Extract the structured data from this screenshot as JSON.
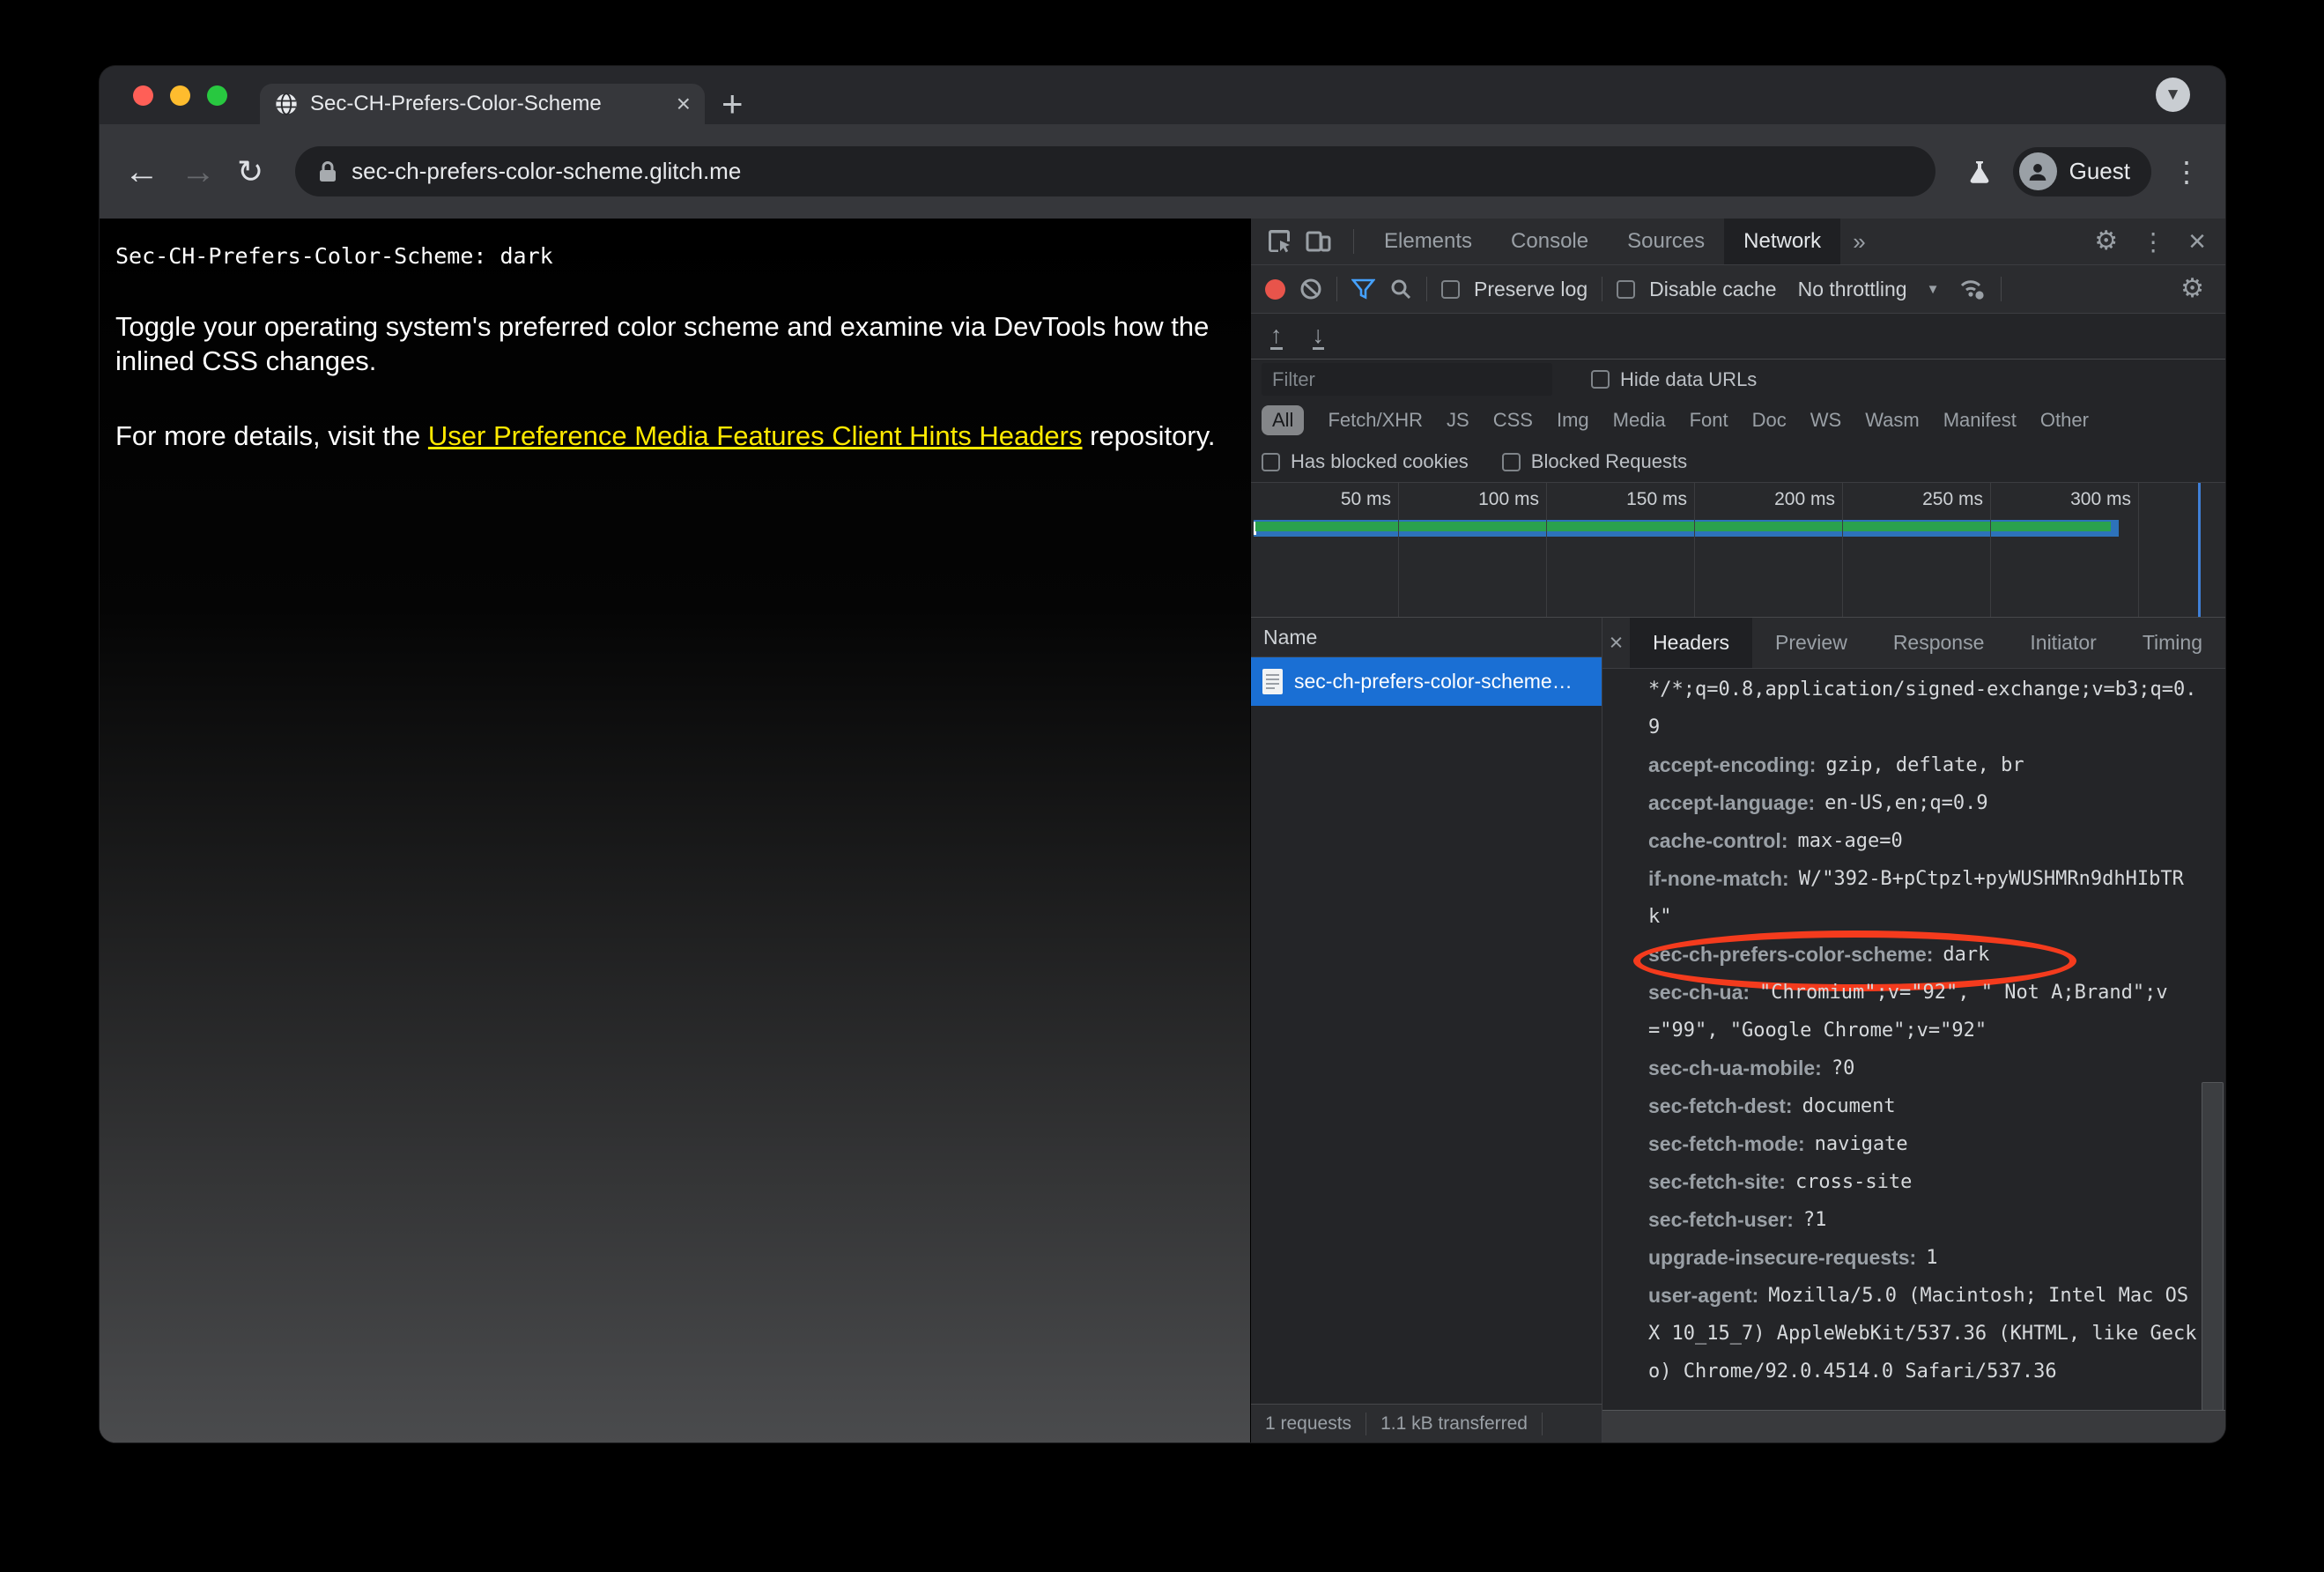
{
  "browser": {
    "tab_title": "Sec-CH-Prefers-Color-Scheme",
    "new_tab_label": "+",
    "url": "sec-ch-prefers-color-scheme.glitch.me",
    "profile_label": "Guest"
  },
  "page": {
    "header_line": "Sec-CH-Prefers-Color-Scheme: dark",
    "para1": "Toggle your operating system's preferred color scheme and examine via DevTools how the inlined CSS changes.",
    "para2_prefix": "For more details, visit the ",
    "link_text": "User Preference Media Features Client Hints Headers",
    "para2_suffix": " repository."
  },
  "devtools": {
    "tabs": [
      "Elements",
      "Console",
      "Sources",
      "Network"
    ],
    "active_tab": "Network",
    "more_tabs_glyph": "»",
    "toolbar": {
      "preserve_log": "Preserve log",
      "disable_cache": "Disable cache",
      "throttling": "No throttling"
    },
    "filter_placeholder": "Filter",
    "hide_data_urls": "Hide data URLs",
    "chips": [
      "All",
      "Fetch/XHR",
      "JS",
      "CSS",
      "Img",
      "Media",
      "Font",
      "Doc",
      "WS",
      "Wasm",
      "Manifest",
      "Other"
    ],
    "active_chip": "All",
    "blocked_cookies_label": "Has blocked cookies",
    "blocked_requests_label": "Blocked Requests",
    "timeline_ticks": [
      "50 ms",
      "100 ms",
      "150 ms",
      "200 ms",
      "250 ms",
      "300 ms"
    ],
    "name_column": "Name",
    "request_name": "sec-ch-prefers-color-scheme…",
    "detail_tabs": [
      "Headers",
      "Preview",
      "Response",
      "Initiator",
      "Timing"
    ],
    "active_detail_tab": "Headers",
    "header_lines": [
      {
        "name": "",
        "value": "*/*;q=0.8,application/signed-exchange;v=b3;q=0."
      },
      {
        "name": "",
        "value": "9"
      },
      {
        "name": "accept-encoding:",
        "value": "gzip, deflate, br"
      },
      {
        "name": "accept-language:",
        "value": "en-US,en;q=0.9"
      },
      {
        "name": "cache-control:",
        "value": "max-age=0"
      },
      {
        "name": "if-none-match:",
        "value": "W/\"392-B+pCtpzl+pyWUSHMRn9dhHIbTR"
      },
      {
        "name": "",
        "value": "k\""
      },
      {
        "name": "sec-ch-prefers-color-scheme:",
        "value": "dark",
        "circled": true
      },
      {
        "name": "sec-ch-ua:",
        "value": "\"Chromium\";v=\"92\", \" Not A;Brand\";v"
      },
      {
        "name": "",
        "value": "=\"99\", \"Google Chrome\";v=\"92\""
      },
      {
        "name": "sec-ch-ua-mobile:",
        "value": "?0"
      },
      {
        "name": "sec-fetch-dest:",
        "value": "document"
      },
      {
        "name": "sec-fetch-mode:",
        "value": "navigate"
      },
      {
        "name": "sec-fetch-site:",
        "value": "cross-site"
      },
      {
        "name": "sec-fetch-user:",
        "value": "?1"
      },
      {
        "name": "upgrade-insecure-requests:",
        "value": "1"
      },
      {
        "name": "user-agent:",
        "value": "Mozilla/5.0 (Macintosh; Intel Mac OS"
      },
      {
        "name": "",
        "value": "X 10_15_7) AppleWebKit/537.36 (KHTML, like Geck"
      },
      {
        "name": "",
        "value": "o) Chrome/92.0.4514.0 Safari/537.36"
      }
    ],
    "status": {
      "requests": "1 requests",
      "transferred": "1.1 kB transferred"
    }
  },
  "colors": {
    "selected_row_blue": "#1a6fd4",
    "record_red": "#e8544b",
    "filter_funnel_blue": "#45a1ff",
    "waterfall_green": "#2aa14d",
    "waterfall_blue": "#2d72ba",
    "load_event_blue": "#3f7fd6",
    "annotation_red": "#f43b1d",
    "link_yellow": "#ffe900",
    "traffic_red": "#ff5f57",
    "traffic_yellow": "#febc2e",
    "traffic_green": "#28c840"
  }
}
